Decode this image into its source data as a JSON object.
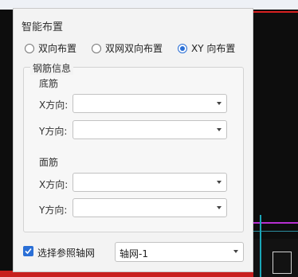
{
  "panel": {
    "title": "智能布置",
    "radios": [
      {
        "label": "双向布置",
        "checked": false
      },
      {
        "label": "双网双向布置",
        "checked": false
      },
      {
        "label": "XY 向布置",
        "checked": true
      }
    ],
    "rebar_group": {
      "title": "钢筋信息",
      "bottom": {
        "label": "底筋",
        "x_label": "X方向:",
        "y_label": "Y方向:",
        "x_value": "",
        "y_value": ""
      },
      "top": {
        "label": "面筋",
        "x_label": "X方向:",
        "y_label": "Y方向:",
        "x_value": "",
        "y_value": ""
      }
    },
    "ref_grid": {
      "checkbox_label": "选择参照轴网",
      "checked": true,
      "select_value": "轴网-1"
    }
  },
  "colors": {
    "accent": "#2a6fd6",
    "panel_bg": "#f3f3f3",
    "cad_bg": "#0d0d0d"
  }
}
